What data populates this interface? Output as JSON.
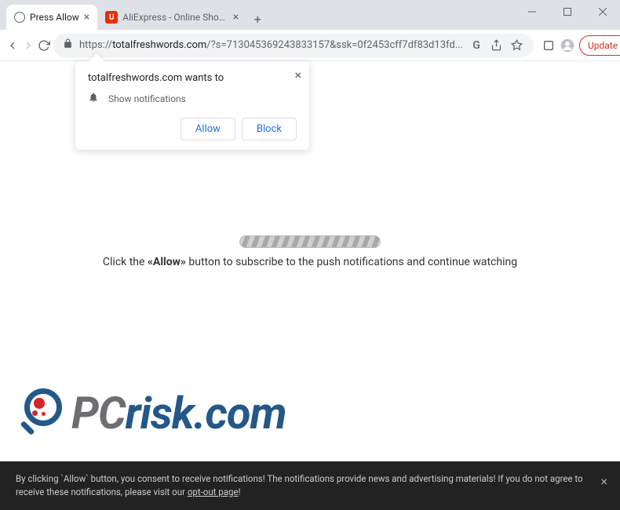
{
  "window": {
    "tabs": [
      {
        "title": "Press Allow",
        "favicon": "globe",
        "active": true
      },
      {
        "title": "AliExpress - Online Shopping fo",
        "favicon": "ali",
        "active": false
      }
    ]
  },
  "toolbar": {
    "url_protocol": "https://",
    "url_host": "totalfreshwords.com",
    "url_path": "/?s=713045369243833157&ssk=0f2453cff7df83d13fd...",
    "update_label": "Update"
  },
  "permission": {
    "title": "totalfreshwords.com wants to",
    "capability": "Show notifications",
    "allow": "Allow",
    "block": "Block"
  },
  "page": {
    "instruction_pre": "Click the ",
    "instruction_bold": "«Allow»",
    "instruction_post": " button to subscribe to the push notifications and continue watching"
  },
  "watermark": {
    "pc": "PC",
    "risk": "risk.com"
  },
  "cookie": {
    "text_1": "By clicking `Allow` button, you consent to receive notifications! The notifications provide news and advertising materials! If you do not agree to receive these notifications, please visit our ",
    "link": "opt-out page",
    "text_2": "!"
  }
}
